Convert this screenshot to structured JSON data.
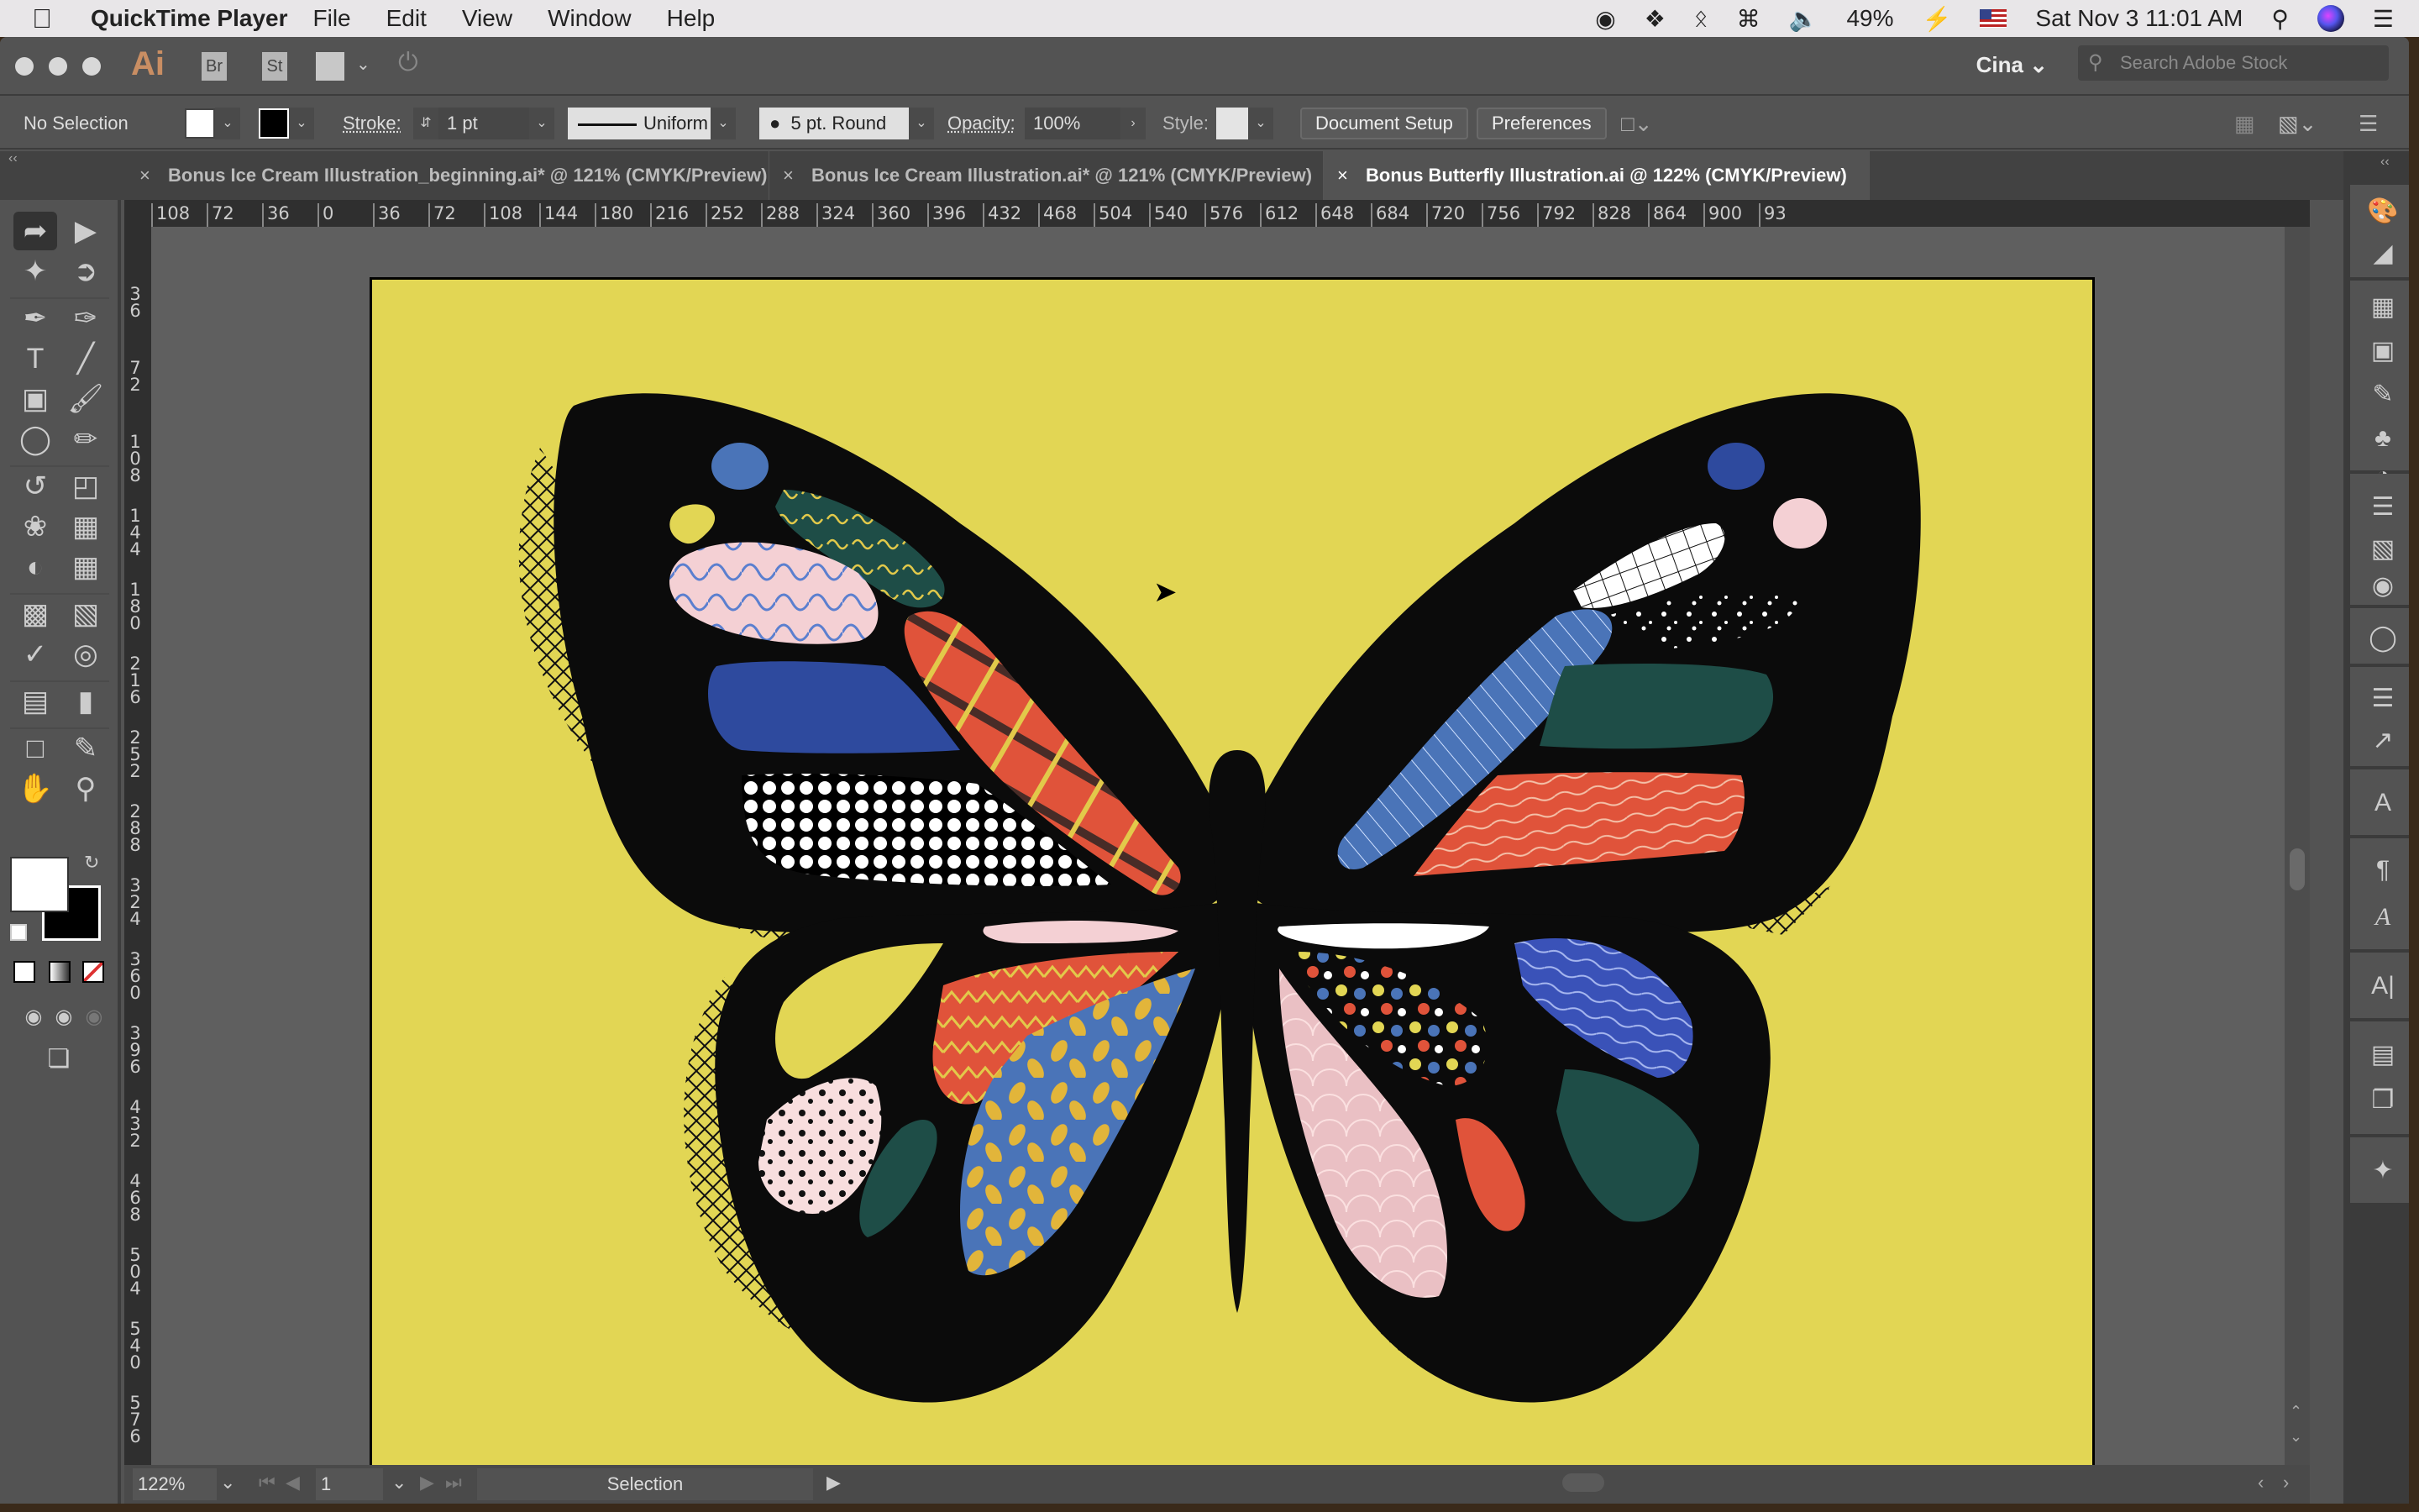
{
  "menubar": {
    "app_name": "QuickTime Player",
    "items": [
      "File",
      "Edit",
      "View",
      "Window",
      "Help"
    ],
    "battery": "49%",
    "datetime": "Sat Nov 3  11:01 AM"
  },
  "appbar": {
    "logo": "Ai",
    "bridge": "Br",
    "stock": "St",
    "workspace": "Cina",
    "search_placeholder": "Search Adobe Stock"
  },
  "controlbar": {
    "selection": "No Selection",
    "stroke_label": "Stroke:",
    "stroke_value": "1 pt",
    "profile": "Uniform",
    "brush": "5 pt. Round",
    "opacity_label": "Opacity:",
    "opacity_value": "100%",
    "style_label": "Style:",
    "document_setup": "Document Setup",
    "preferences": "Preferences"
  },
  "tabs": [
    {
      "label": "Bonus Ice Cream Illustration_beginning.ai* @ 121% (CMYK/Preview)",
      "active": false
    },
    {
      "label": "Bonus Ice Cream Illustration.ai* @ 121% (CMYK/Preview)",
      "active": false
    },
    {
      "label": "Bonus Butterfly Illustration.ai @ 122% (CMYK/Preview)",
      "active": true
    }
  ],
  "ruler_h": [
    "108",
    "72",
    "36",
    "0",
    "36",
    "72",
    "108",
    "144",
    "180",
    "216",
    "252",
    "288",
    "324",
    "360",
    "396",
    "432",
    "468",
    "504",
    "540",
    "576",
    "612",
    "648",
    "684",
    "720",
    "756",
    "792",
    "828",
    "864",
    "900",
    "93"
  ],
  "ruler_v": [
    "36",
    "72",
    "108",
    "144",
    "180",
    "216",
    "252",
    "288",
    "324",
    "360",
    "396",
    "432",
    "468",
    "504",
    "540",
    "576"
  ],
  "status": {
    "zoom": "122%",
    "page": "1",
    "mode": "Selection"
  },
  "artwork": {
    "background": "#e2d654",
    "body": "#0b0b0b",
    "colors": {
      "blue": "#2e4a9e",
      "light_blue": "#4a74b8",
      "pink": "#f4d0d4",
      "orange": "#e0533a",
      "green": "#1e4d47",
      "yellow": "#e2c94a",
      "white": "#ffffff"
    }
  }
}
